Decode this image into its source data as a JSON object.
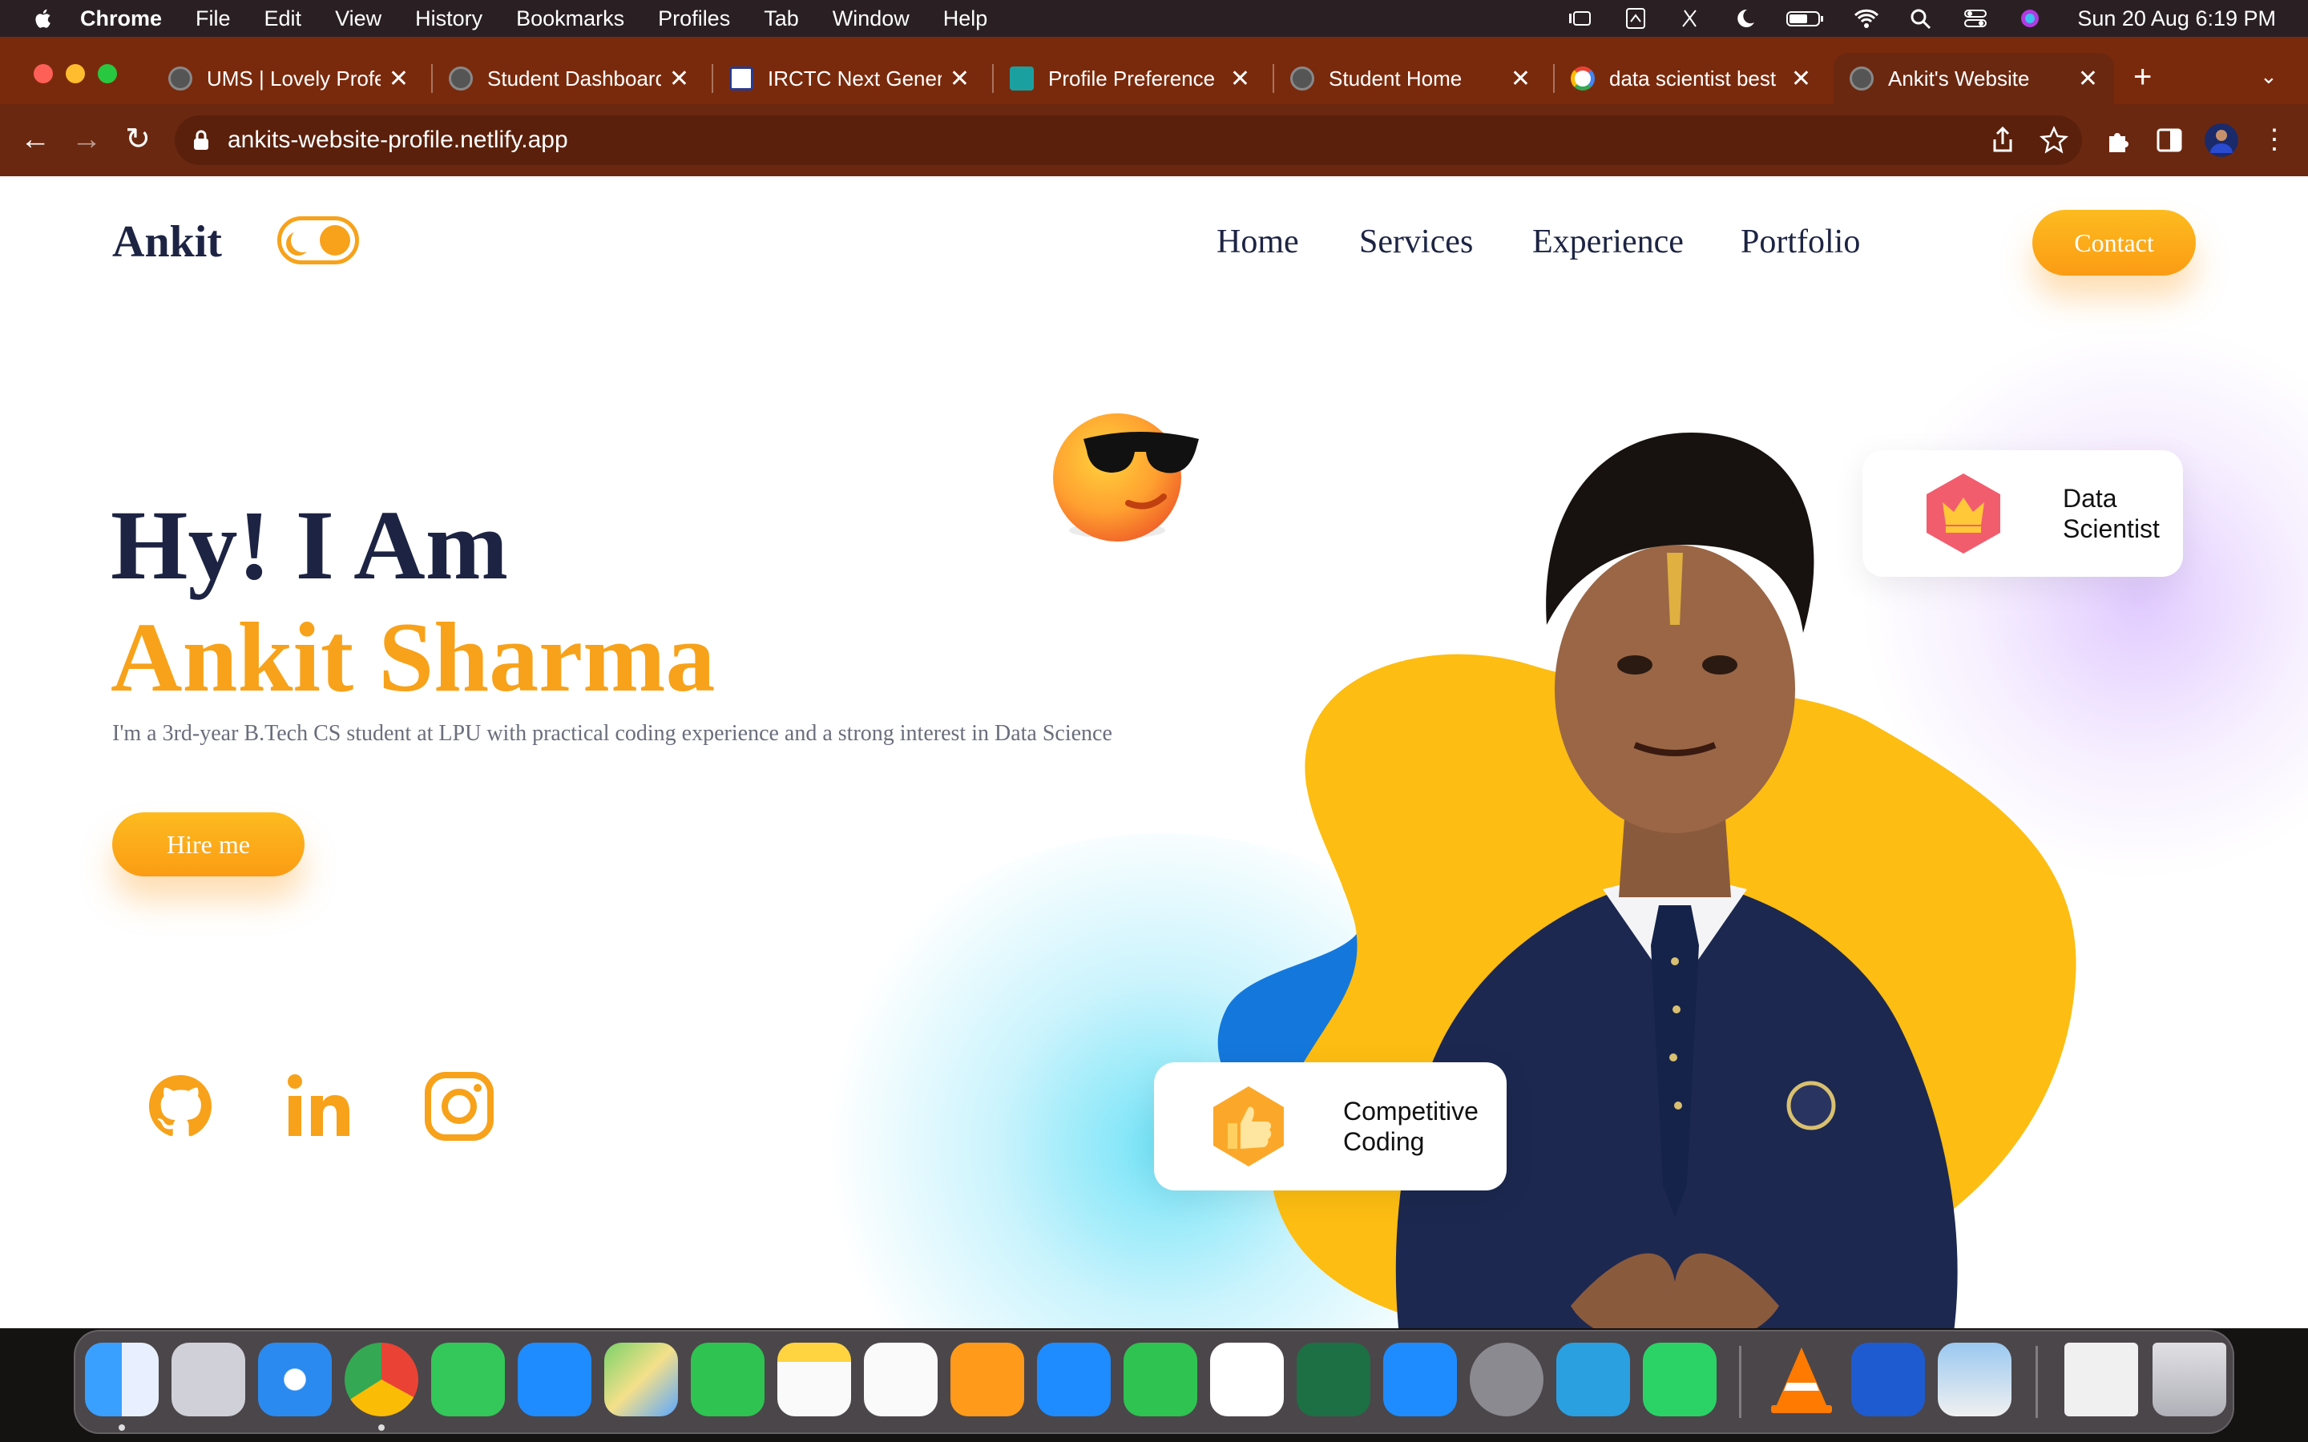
{
  "menubar": {
    "app_name": "Chrome",
    "items": [
      "File",
      "Edit",
      "View",
      "History",
      "Bookmarks",
      "Profiles",
      "Tab",
      "Window",
      "Help"
    ],
    "clock": "Sun 20 Aug  6:19 PM"
  },
  "browser": {
    "tabs": [
      {
        "label": "UMS | Lovely Profes"
      },
      {
        "label": "Student Dashboard"
      },
      {
        "label": "IRCTC Next Genera"
      },
      {
        "label": "Profile Preference F"
      },
      {
        "label": "Student Home"
      },
      {
        "label": "data scientist best"
      },
      {
        "label": "Ankit's Website",
        "active": true
      }
    ],
    "url": "ankits-website-profile.netlify.app"
  },
  "site": {
    "logo": "Ankit",
    "nav": [
      "Home",
      "Services",
      "Experience",
      "Portfolio"
    ],
    "contact_label": "Contact",
    "hero_line1": "Hy! I Am",
    "hero_line2": "Ankit Sharma",
    "description": "I'm a 3rd-year B.Tech CS student at LPU with practical coding experience and a strong interest in Data Science",
    "hire_label": "Hire me",
    "socials": [
      "github-icon",
      "linkedin-icon",
      "instagram-icon"
    ],
    "card_data_scientist": {
      "line1": "Data",
      "line2": "Scientist"
    },
    "card_coding": {
      "line1": "Competitive",
      "line2": "Coding"
    }
  },
  "dock": {
    "apps": [
      "Finder",
      "Launchpad",
      "Safari",
      "Chrome",
      "Messages",
      "Mail",
      "Maps",
      "FaceTime",
      "Notes",
      "Reminders",
      "Pages",
      "Keynote",
      "Numbers",
      "VS Code",
      "Excel",
      "App Store",
      "System Settings",
      "Telegram",
      "WhatsApp",
      "VLC",
      "Word",
      "Preview",
      "Documents",
      "Trash"
    ]
  },
  "colors": {
    "accent": "#f7a21a",
    "navy": "#1d2443",
    "browser": "#7a2a0c",
    "blob_yellow": "#fdbd12",
    "blob_blue": "#1477dc"
  }
}
